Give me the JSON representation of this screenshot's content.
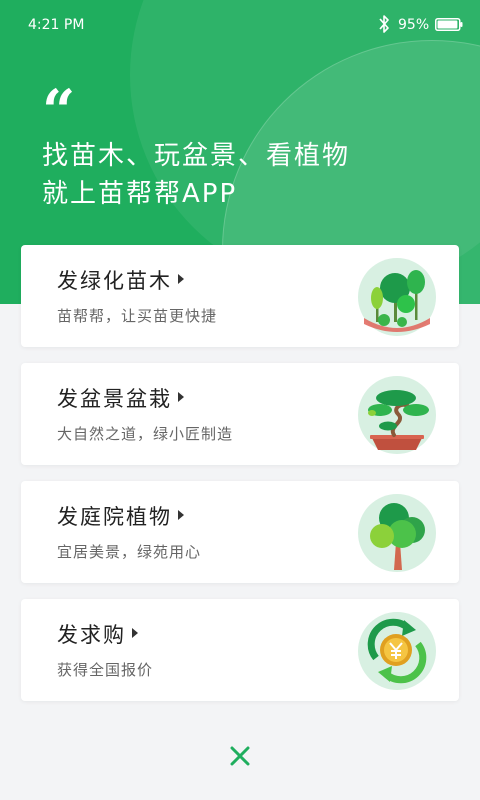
{
  "status_bar": {
    "time": "4:21 PM",
    "battery_percent": "95%",
    "battery_level": 0.95,
    "icons": [
      "bluetooth-icon",
      "battery-icon"
    ]
  },
  "hero": {
    "quote_mark": "“",
    "slogan_line1": "找苗木、玩盆景、看植物",
    "slogan_line2": "就上苗帮帮APP"
  },
  "cards": [
    {
      "title": "发绿化苗木",
      "subtitle": "苗帮帮，让买苗更快捷",
      "icon": "greening-trees-icon"
    },
    {
      "title": "发盆景盆栽",
      "subtitle": "大自然之道，绿小匠制造",
      "icon": "bonsai-icon"
    },
    {
      "title": "发庭院植物",
      "subtitle": "宜居美景，绿苑用心",
      "icon": "courtyard-tree-icon"
    },
    {
      "title": "发求购",
      "subtitle": "获得全国报价",
      "icon": "purchase-request-icon"
    }
  ],
  "close_icon": "close-icon",
  "colors": {
    "brand_green": "#1fae5e",
    "background": "#f3f4f6",
    "icon_circle": "#d8f0e2"
  }
}
